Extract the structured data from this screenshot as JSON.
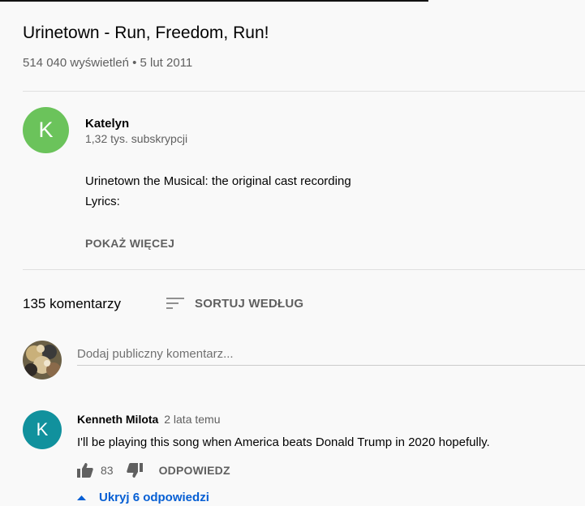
{
  "video": {
    "title": "Urinetown - Run, Freedom, Run!",
    "meta": "514 040 wyświetleń • 5 lut 2011"
  },
  "channel": {
    "avatar_letter": "K",
    "name": "Katelyn",
    "subscribers": "1,32 tys. subskrypcji"
  },
  "description": {
    "line1": "Urinetown the Musical: the original cast recording",
    "line2": "Lyrics:",
    "show_more": "POKAŻ WIĘCEJ"
  },
  "comments_header": {
    "count": "135 komentarzy",
    "sort_label": "SORTUJ WEDŁUG"
  },
  "comment_box": {
    "placeholder": "Dodaj publiczny komentarz..."
  },
  "comments": [
    {
      "avatar_letter": "K",
      "author": "Kenneth Milota",
      "time": "2 lata temu",
      "text": "I'll be playing this song when America beats Donald Trump in 2020 hopefully.",
      "likes": "83",
      "reply_label": "ODPOWIEDZ",
      "hide_replies_label": "Ukryj 6 odpowiedzi"
    }
  ],
  "icons": {
    "sort": "sort-icon",
    "like": "thumb-up-icon",
    "dislike": "thumb-down-icon",
    "collapse": "caret-up-icon"
  },
  "colors": {
    "background": "#f9f9f9",
    "channel_avatar": "#6bc35b",
    "commenter_avatar": "#11919d",
    "link_blue": "#065fd4",
    "secondary_text": "#606060"
  }
}
